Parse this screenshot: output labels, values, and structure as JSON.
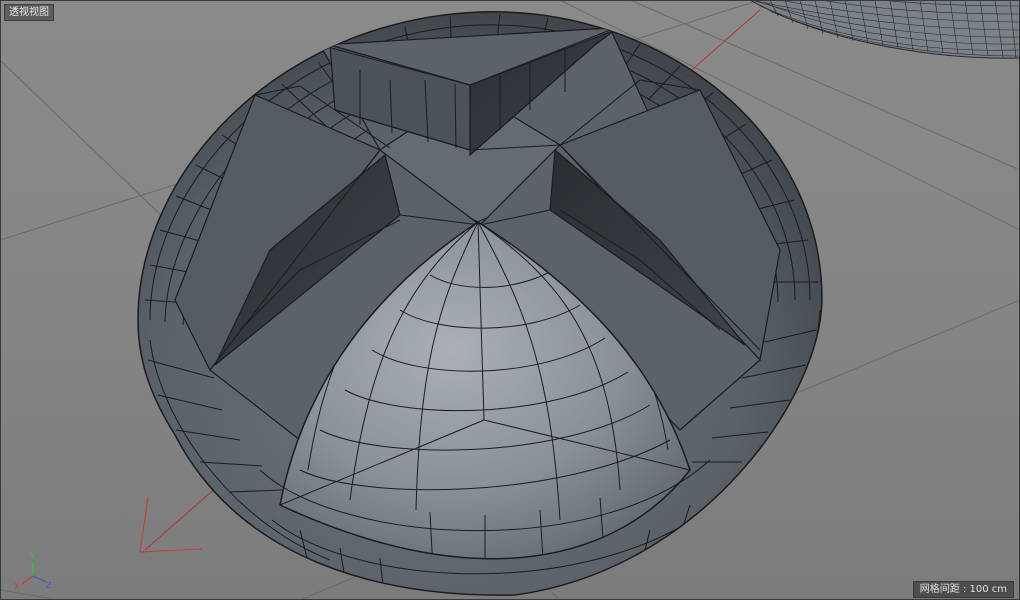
{
  "viewport": {
    "label": "透视视图",
    "grid_spacing_label": "网格间距 : 100 cm"
  },
  "axis_gizmo": {
    "x": "X",
    "y": "Y",
    "z": "Z"
  },
  "colors": {
    "background": "#858585",
    "mesh_dark": "#50575f",
    "mesh_light": "#a7adb3",
    "wire": "#1c1c1c",
    "gizmo_x": "#c43c3c",
    "gizmo_y": "#3fbf3f",
    "gizmo_z": "#3c5ccc"
  }
}
